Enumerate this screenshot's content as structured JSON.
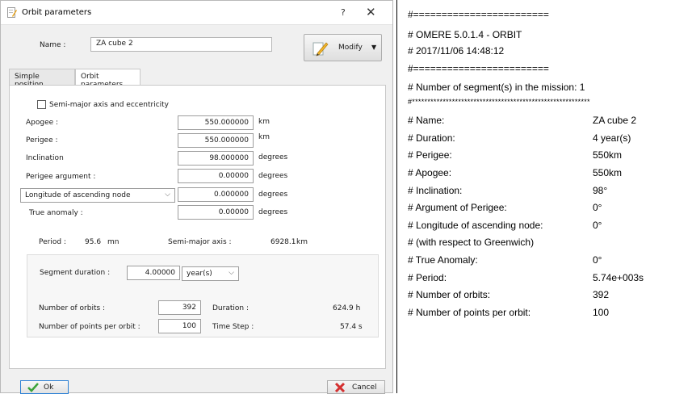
{
  "dialog": {
    "title": "Orbit parameters",
    "help": "?",
    "close": "✕",
    "name_label": "Name :",
    "name_value": "ZA cube 2",
    "modify_label": "Modify",
    "tabs": [
      {
        "label": "Simple position"
      },
      {
        "label": "Orbit parameters"
      }
    ],
    "semi_major_checkbox_label": "Semi-major axis and eccentricity",
    "fields": {
      "apogee": {
        "label": "Apogee :",
        "value": "550.000000",
        "unit": "km"
      },
      "perigee": {
        "label": "Perigee :",
        "value": "550.000000",
        "unit": "km"
      },
      "inclination": {
        "label": "Inclination",
        "value": "98.000000",
        "unit": "degrees"
      },
      "perigee_argument": {
        "label": "Perigee argument :",
        "value": "0.00000",
        "unit": "degrees"
      },
      "longitude": {
        "label": "Longitude of ascending node",
        "value": "0.000000",
        "unit": "degrees"
      },
      "true_anomaly": {
        "label": "True anomaly :",
        "value": "0.00000",
        "unit": "degrees"
      }
    },
    "period": {
      "label": "Period :",
      "value": "95.6",
      "unit": "mn"
    },
    "semi_major_axis": {
      "label": "Semi-major axis :",
      "value": "6928.1",
      "unit": "km"
    },
    "segment": {
      "duration_label": "Segment duration :",
      "duration_value": "4.00000",
      "duration_unit": "year(s)",
      "orbits_label": "Number of orbits :",
      "orbits_value": "392",
      "duration_info_label": "Duration :",
      "duration_info_value": "624.9 h",
      "points_label": "Number of points per orbit :",
      "points_value": "100",
      "timestep_label": "Time Step :",
      "timestep_value": "57.4 s"
    },
    "ok_label": "Ok",
    "cancel_label": "Cancel"
  },
  "report": {
    "sep1": "#========================",
    "header1": "# OMERE 5.0.1.4 - ORBIT",
    "header2": "# 2017/11/06   14:48:12",
    "sep2": "#========================",
    "segments": "# Number of segment(s) in the mission: 1",
    "stars": "#**********************************************************",
    "rows": [
      {
        "key": "# Name:",
        "value": "ZA cube 2"
      },
      {
        "key": "# Duration:",
        "value": "4 year(s)"
      },
      {
        "key": "# Perigee:",
        "value": "550km"
      },
      {
        "key": "# Apogee:",
        "value": "550km"
      },
      {
        "key": "# Inclination:",
        "value": "98°"
      },
      {
        "key": "# Argument of Perigee:",
        "value": "0°"
      },
      {
        "key": "# Longitude of ascending node:",
        "value": "0°"
      },
      {
        "key": "# (with respect to Greenwich)",
        "value": ""
      },
      {
        "key": "# True Anomaly:",
        "value": "0°"
      },
      {
        "key": "# Period:",
        "value": "5.74e+003s"
      },
      {
        "key": "# Number of orbits:",
        "value": "392"
      },
      {
        "key": "# Number of points per orbit:",
        "value": "100"
      }
    ]
  }
}
